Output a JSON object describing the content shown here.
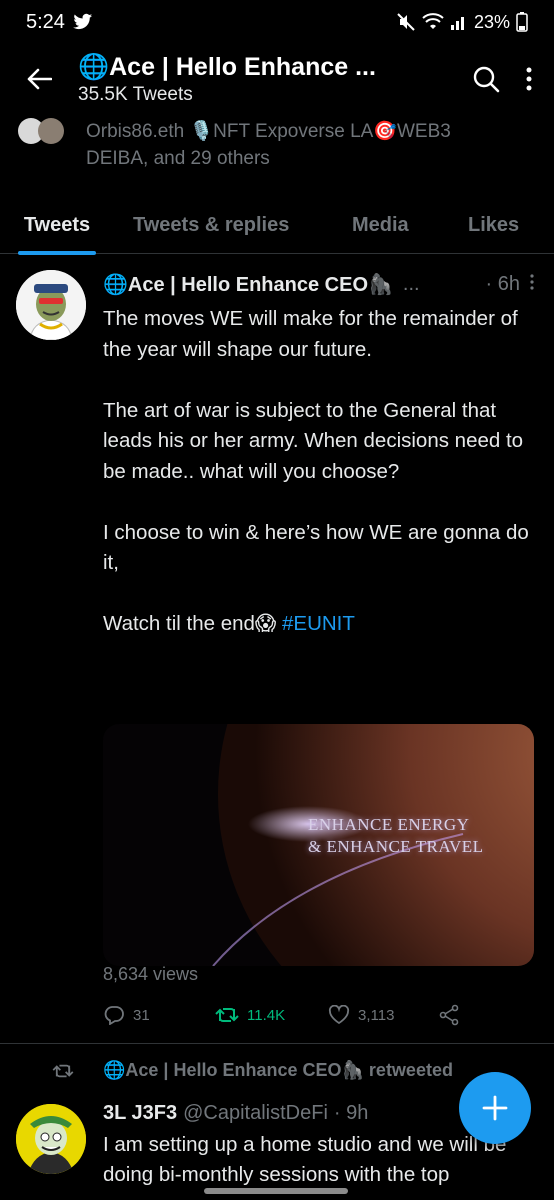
{
  "status": {
    "time": "5:24",
    "battery": "23%"
  },
  "header": {
    "title": "🌐Ace | Hello Enhance ...",
    "subtitle": "35.5K Tweets"
  },
  "followers": {
    "line1": "Orbis86.eth 🎙️NFT Expoverse LA🎯WEB3",
    "line2": "DEIBA, and 29 others"
  },
  "tabs": [
    {
      "label": "Tweets"
    },
    {
      "label": "Tweets & replies"
    },
    {
      "label": "Media"
    },
    {
      "label": "Likes"
    }
  ],
  "tweet": {
    "name": "🌐Ace | Hello Enhance CEO🦍",
    "more": "...",
    "time": "· 6h",
    "p1": "The moves WE will make for the remainder of the year will shape our future.",
    "p2": "The art of war is subject to the General that leads his or her army. When decisions need to be made.. what will you choose?",
    "p3": "I choose to win & here’s how WE are gonna do it,",
    "p4_prefix": "Watch til the end😱 ",
    "hashtag": "#EUNIT",
    "media_line1": "ENHANCE ENERGY",
    "media_line2": "& ENHANCE TRAVEL",
    "views": "8,634 views",
    "replies": "31",
    "retweets": "11.4K",
    "likes": "3,113"
  },
  "tweet2": {
    "retweeted_by": "🌐Ace | Hello Enhance CEO🦍 retweeted",
    "name": "3L J3F3",
    "handle": "@CapitalistDeFi",
    "time": "· 9h",
    "text": "I am setting up a home studio and we will be doing bi-monthly sessions with the top"
  },
  "colors": {
    "accent": "#1d9bf0",
    "retweet": "#00ba7c",
    "muted": "#71767b"
  }
}
